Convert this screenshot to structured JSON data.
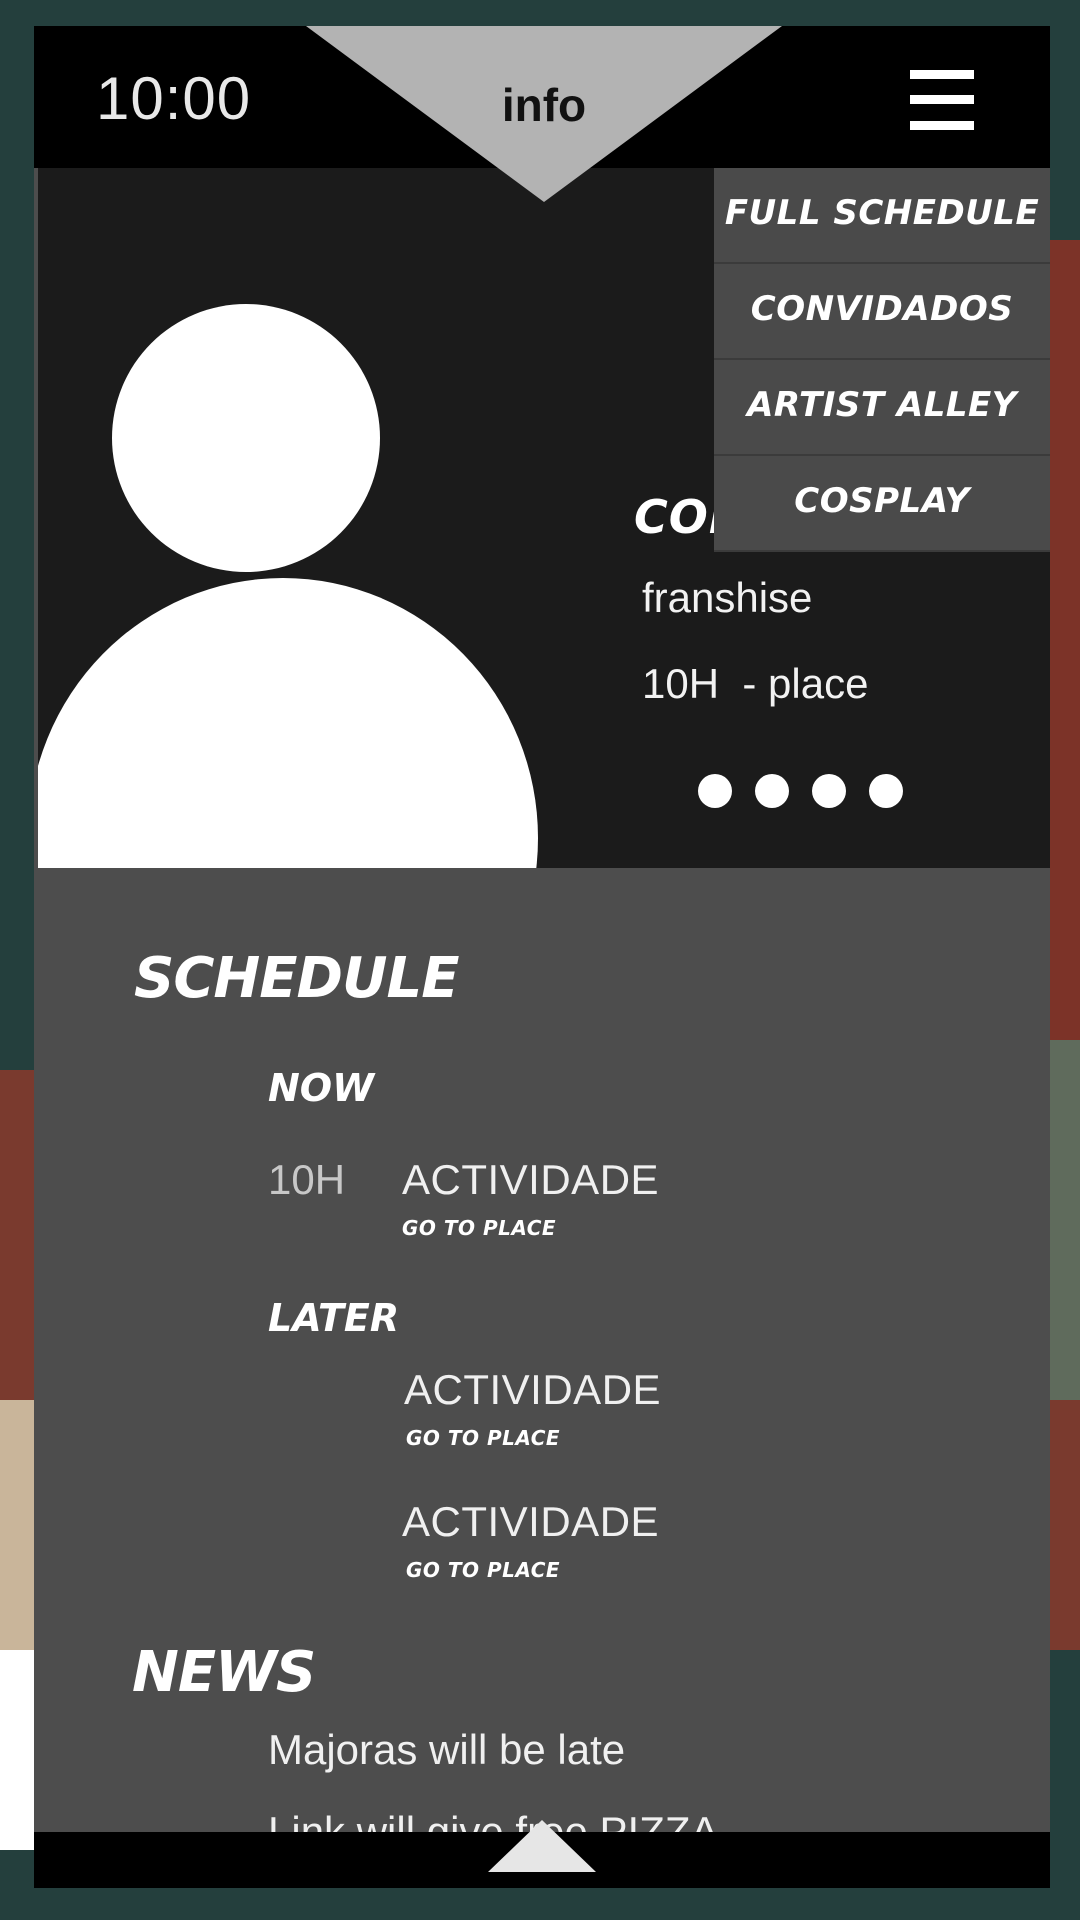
{
  "status_bar": {
    "time": "10:00"
  },
  "header": {
    "tab_label": "info",
    "menu_icon": "hamburger-menu-icon"
  },
  "menu": {
    "items": [
      {
        "label": "FULL SCHEDULE"
      },
      {
        "label": "CONVIDADOS"
      },
      {
        "label": "ARTIST ALLEY"
      },
      {
        "label": "COSPLAY"
      }
    ]
  },
  "featured": {
    "name": "CON",
    "franchise": "franshise",
    "time_place": "10H  - place",
    "avatar_icon": "person-placeholder-icon",
    "pager_dots": 4
  },
  "schedule": {
    "title": "SCHEDULE",
    "now_label": "NOW",
    "now": [
      {
        "time": "10H",
        "activity": "ACTIVIDADE",
        "place": "GO TO PLACE"
      }
    ],
    "later_label": "LATER",
    "later": [
      {
        "activity": "ACTIVIDADE",
        "place": "GO TO PLACE"
      },
      {
        "activity": "ACTIVIDADE",
        "place": "GO TO PLACE"
      }
    ]
  },
  "news": {
    "title": "NEWS",
    "items": [
      "Majoras will be late",
      "Link will give free PIZZA"
    ]
  },
  "footer": {
    "scroll_up_icon": "up-arrow-icon"
  },
  "colors": {
    "background": "#243f3d",
    "panel": "#4d4d4d",
    "hero": "#1b1b1b",
    "bar": "#000000",
    "tab": "#b3b3b3",
    "menu": "#4a4a4a"
  }
}
